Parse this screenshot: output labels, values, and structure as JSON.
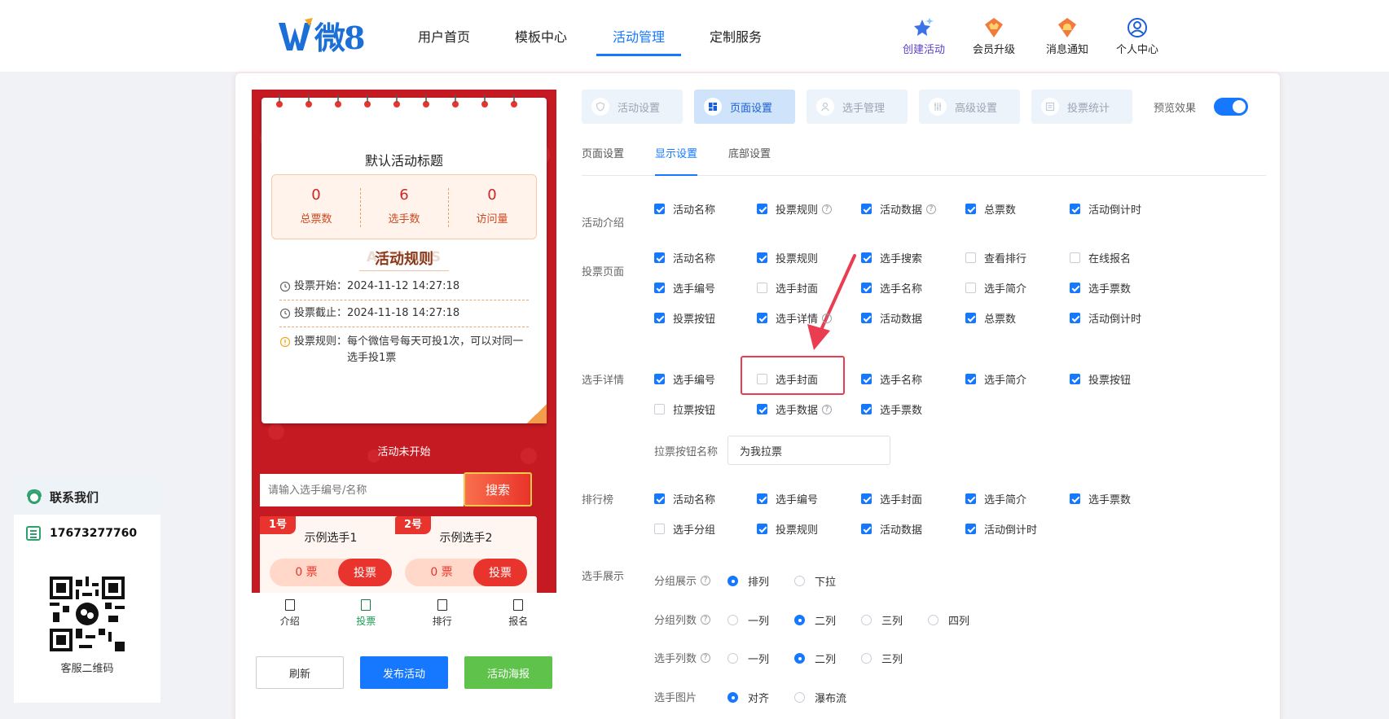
{
  "brand": {
    "logo_text": "微8",
    "accent": "#1677ff"
  },
  "nav": {
    "items": [
      "用户首页",
      "模板中心",
      "活动管理",
      "定制服务"
    ],
    "active_index": 2
  },
  "top_tools": [
    {
      "label": "创建活动",
      "icon": "star-sparkle-icon",
      "color": "#5b3ec7"
    },
    {
      "label": "会员升级",
      "icon": "crown-badge-icon"
    },
    {
      "label": "消息通知",
      "icon": "bell-badge-icon"
    },
    {
      "label": "个人中心",
      "icon": "user-circle-icon"
    }
  ],
  "contact": {
    "title": "联系我们",
    "phone": "17673277760",
    "qr_label": "客服二维码"
  },
  "phone_preview": {
    "title": "默认活动标题",
    "stats": [
      {
        "value": "0",
        "label": "总票数"
      },
      {
        "value": "6",
        "label": "选手数"
      },
      {
        "value": "0",
        "label": "访问量"
      }
    ],
    "rules_bg": "ACTI      LES",
    "rules_title": "活动规则",
    "start_label": "投票开始：",
    "start_value": "2024-11-12 14:27:18",
    "end_label": "投票截止：",
    "end_value": "2024-11-18 14:27:18",
    "rule_label": "投票规则：",
    "rule_value": "每个微信号每天可投1次，可以对同一选手投1票",
    "status": "活动未开始",
    "search_placeholder": "请输入选手编号/名称",
    "search_button": "搜索",
    "players": [
      {
        "badge": "1号",
        "name": "示例选手1",
        "votes": "0 票",
        "vote_btn": "投票"
      },
      {
        "badge": "2号",
        "name": "示例选手2",
        "votes": "0 票",
        "vote_btn": "投票"
      }
    ],
    "tabs": [
      "介绍",
      "投票",
      "排行",
      "报名"
    ],
    "active_tab": 1
  },
  "actions": {
    "refresh": "刷新",
    "publish": "发布活动",
    "poster": "活动海报"
  },
  "setting_tabs": [
    {
      "label": "活动设置",
      "icon": "shield-icon"
    },
    {
      "label": "页面设置",
      "icon": "layout-icon"
    },
    {
      "label": "选手管理",
      "icon": "user-icon"
    },
    {
      "label": "高级设置",
      "icon": "sliders-icon"
    },
    {
      "label": "投票统计",
      "icon": "list-icon"
    }
  ],
  "active_setting_tab": 1,
  "preview_label": "预览效果",
  "preview_on": true,
  "sub_tabs": [
    "页面设置",
    "显示设置",
    "底部设置"
  ],
  "active_sub_tab": 1,
  "sections": {
    "intro": {
      "label": "活动介绍",
      "items": [
        {
          "label": "活动名称",
          "checked": true
        },
        {
          "label": "投票规则",
          "checked": true,
          "help": true
        },
        {
          "label": "活动数据",
          "checked": true,
          "help": true
        },
        {
          "label": "总票数",
          "checked": true
        },
        {
          "label": "活动倒计时",
          "checked": true
        }
      ]
    },
    "vote": {
      "label": "投票页面",
      "items": [
        {
          "label": "活动名称",
          "checked": true
        },
        {
          "label": "投票规则",
          "checked": true
        },
        {
          "label": "选手搜索",
          "checked": true
        },
        {
          "label": "查看排行",
          "checked": false
        },
        {
          "label": "在线报名",
          "checked": false
        },
        {
          "label": "选手编号",
          "checked": true
        },
        {
          "label": "选手封面",
          "checked": false
        },
        {
          "label": "选手名称",
          "checked": true
        },
        {
          "label": "选手简介",
          "checked": false
        },
        {
          "label": "选手票数",
          "checked": true
        },
        {
          "label": "投票按钮",
          "checked": true
        },
        {
          "label": "选手详情",
          "checked": true,
          "help": true
        },
        {
          "label": "活动数据",
          "checked": true
        },
        {
          "label": "总票数",
          "checked": true
        },
        {
          "label": "活动倒计时",
          "checked": true
        }
      ]
    },
    "detail": {
      "label": "选手详情",
      "items": [
        {
          "label": "选手编号",
          "checked": true
        },
        {
          "label": "选手封面",
          "checked": false
        },
        {
          "label": "选手名称",
          "checked": true
        },
        {
          "label": "选手简介",
          "checked": true
        },
        {
          "label": "投票按钮",
          "checked": true
        },
        {
          "label": "拉票按钮",
          "checked": false
        },
        {
          "label": "选手数据",
          "checked": true,
          "help": true
        },
        {
          "label": "选手票数",
          "checked": true
        }
      ],
      "canvass_label": "拉票按钮名称",
      "canvass_value": "为我拉票"
    },
    "rank": {
      "label": "排行榜",
      "items": [
        {
          "label": "活动名称",
          "checked": true
        },
        {
          "label": "选手编号",
          "checked": true
        },
        {
          "label": "选手封面",
          "checked": true
        },
        {
          "label": "选手简介",
          "checked": true
        },
        {
          "label": "选手票数",
          "checked": true
        },
        {
          "label": "选手分组",
          "checked": false
        },
        {
          "label": "投票规则",
          "checked": true
        },
        {
          "label": "活动数据",
          "checked": true
        },
        {
          "label": "活动倒计时",
          "checked": true
        }
      ]
    },
    "display": {
      "label": "选手展示",
      "rows": [
        {
          "label": "分组展示",
          "help": true,
          "options": [
            "排列",
            "下拉"
          ],
          "selected": 0
        },
        {
          "label": "分组列数",
          "help": true,
          "options": [
            "一列",
            "二列",
            "三列",
            "四列"
          ],
          "selected": 1
        },
        {
          "label": "选手列数",
          "help": true,
          "options": [
            "一列",
            "二列",
            "三列"
          ],
          "selected": 1
        },
        {
          "label": "选手图片",
          "help": false,
          "options": [
            "对齐",
            "瀑布流"
          ],
          "selected": 0
        }
      ]
    }
  }
}
